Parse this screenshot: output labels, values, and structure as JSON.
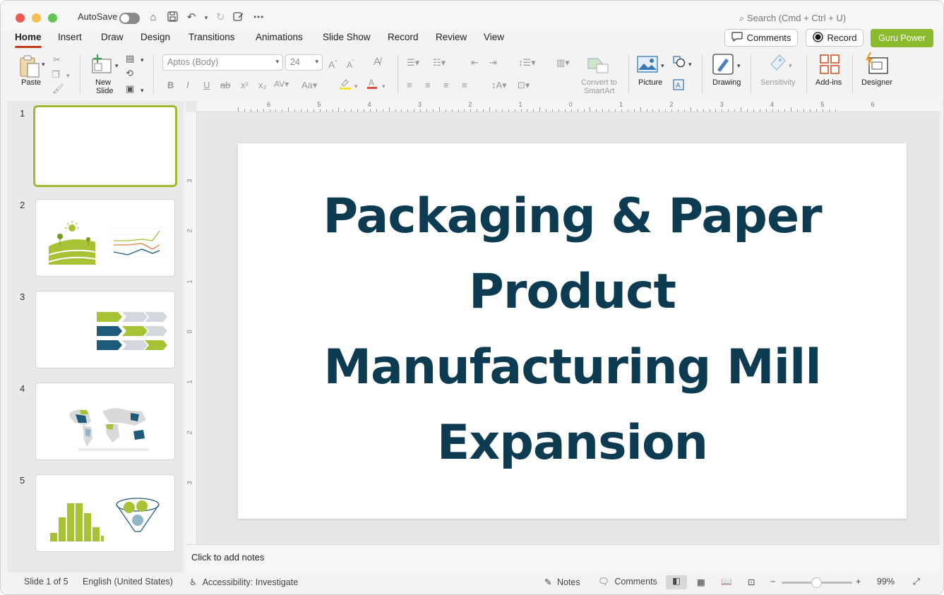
{
  "titlebar": {
    "autosave_label": "AutoSave",
    "search_placeholder": "Search (Cmd + Ctrl + U)",
    "colors": {
      "close": "#ee5a52",
      "minimize": "#f5be4f",
      "zoom": "#5fc454"
    }
  },
  "tabs": [
    {
      "label": "Home",
      "active": true
    },
    {
      "label": "Insert"
    },
    {
      "label": "Draw"
    },
    {
      "label": "Design"
    },
    {
      "label": "Transitions"
    },
    {
      "label": "Animations"
    },
    {
      "label": "Slide Show"
    },
    {
      "label": "Record"
    },
    {
      "label": "Review"
    },
    {
      "label": "View"
    }
  ],
  "header_buttons": {
    "comments": "Comments",
    "record": "Record",
    "guru": "Guru Power"
  },
  "ribbon": {
    "paste": "Paste",
    "new_slide_line1": "New",
    "new_slide_line2": "Slide",
    "font_name": "Aptos (Body)",
    "font_size": "24",
    "convert_line1": "Convert to",
    "convert_line2": "SmartArt",
    "picture": "Picture",
    "drawing": "Drawing",
    "sensitivity": "Sensitivity",
    "addins": "Add-ins",
    "designer": "Designer"
  },
  "thumbnails": [
    {
      "number": "1",
      "selected": true
    },
    {
      "number": "2"
    },
    {
      "number": "3"
    },
    {
      "number": "4"
    },
    {
      "number": "5"
    }
  ],
  "slide": {
    "title_lines": [
      "Packaging & Paper",
      "Product",
      "Manufacturing Mill",
      "Expansion"
    ],
    "title_color": "#0d3b52"
  },
  "ruler": {
    "h_ticks": [
      "6",
      "5",
      "4",
      "3",
      "2",
      "1",
      "0",
      "1",
      "2",
      "3",
      "4",
      "5",
      "6"
    ],
    "v_ticks": [
      "3",
      "2",
      "1",
      "0",
      "1",
      "2",
      "3"
    ]
  },
  "notes_placeholder": "Click to add notes",
  "status": {
    "slide_info": "Slide 1 of 5",
    "language": "English (United States)",
    "accessibility": "Accessibility: Investigate",
    "notes": "Notes",
    "comments": "Comments",
    "zoom": "99%"
  },
  "accent_colors": {
    "brand_green": "#8bbb2d",
    "tab_underline": "#c43e1c",
    "thumb_selected": "#a3b832"
  }
}
